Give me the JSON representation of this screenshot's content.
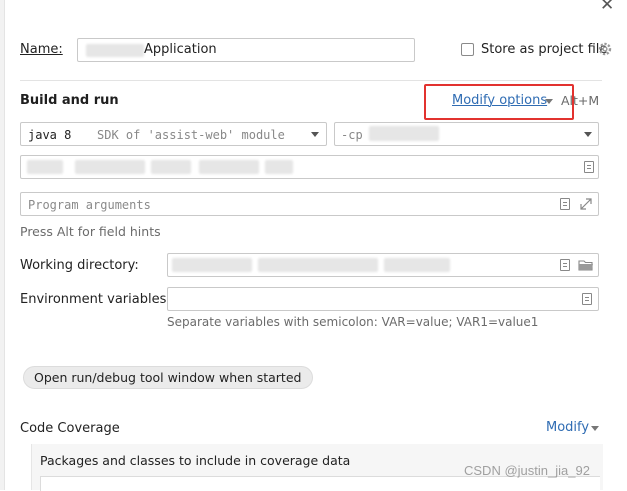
{
  "window": {
    "close_glyph": "✕"
  },
  "name_row": {
    "label": "Name:",
    "value": "Application",
    "store_label": "Store as project file"
  },
  "build_run": {
    "section_title": "Build and run",
    "modify_options_label": "Modify options",
    "modify_options_shortcut": "Alt+M",
    "jdk_value": "java 8",
    "jdk_detail": "SDK of 'assist-web' module",
    "classpath_prefix": "-cp",
    "program_args_placeholder": "Program arguments",
    "field_hint": "Press Alt for field hints"
  },
  "working_dir": {
    "label": "Working directory:"
  },
  "env_vars": {
    "label": "Environment variables:",
    "hint": "Separate variables with semicolon: VAR=value; VAR1=value1"
  },
  "open_window_chip": {
    "label": "Open run/debug tool window when started"
  },
  "code_coverage": {
    "title": "Code Coverage",
    "modify_label": "Modify",
    "packages_label": "Packages and classes to include in coverage data"
  },
  "watermark": "CSDN @justin_jia_92",
  "colors": {
    "link": "#2f6cb3",
    "highlight_box": "#e2322f",
    "chip_bg": "#ebebeb"
  }
}
